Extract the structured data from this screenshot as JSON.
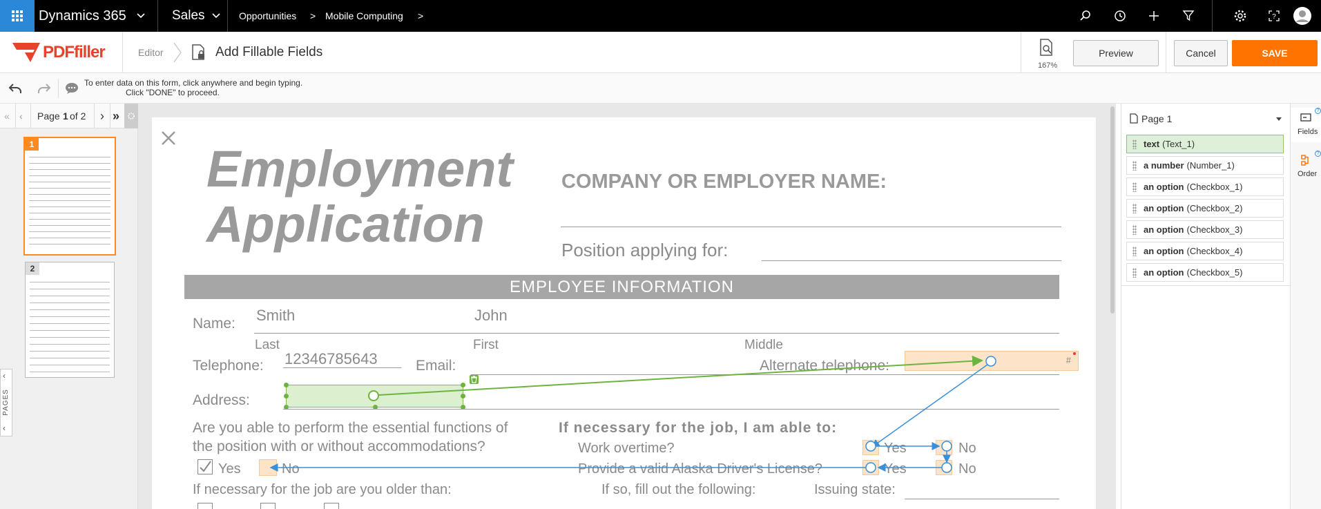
{
  "topbar": {
    "app_name": "Dynamics 365",
    "module": "Sales",
    "breadcrumb": [
      "Opportunities",
      "Mobile Computing"
    ],
    "icons": [
      "search-icon",
      "history-icon",
      "plus-icon",
      "filter-icon",
      "gear-icon",
      "help-icon",
      "user-icon"
    ]
  },
  "editor": {
    "logo": "PDFfiller",
    "crumb_editor": "Editor",
    "title": "Add Fillable Fields",
    "zoom": "167%",
    "preview_label": "Preview",
    "cancel_label": "Cancel",
    "save_label": "SAVE",
    "hint_line1": "To enter data on this form, click anywhere and begin typing.",
    "hint_line2": "Click \"DONE\" to proceed."
  },
  "pager": {
    "prefix": "Page",
    "current": "1",
    "of": "of 2"
  },
  "thumbnails": [
    {
      "num": "1"
    },
    {
      "num": "2"
    }
  ],
  "pages_label": "PAGES",
  "doc": {
    "title1": "Employment",
    "title2": "Application",
    "company": "COMPANY OR EMPLOYER NAME:",
    "position": "Position applying for:",
    "band": "EMPLOYEE INFORMATION",
    "name_label": "Name:",
    "last_value": "Smith",
    "first_value": "John",
    "last_label": "Last",
    "first_label": "First",
    "middle_label": "Middle",
    "telephone_label": "Telephone:",
    "telephone_value": "12346785643",
    "email_label": "Email:",
    "alt_tel_label": "Alternate telephone:",
    "hash": "#",
    "address_label": "Address:",
    "q1_line1": "Are you able to perform the essential functions of",
    "q1_line2": "the position with or without accommodations?",
    "yes": "Yes",
    "no": "No",
    "able_heading": "If necessary for the job, I am able to:",
    "overtime": "Work overtime?",
    "license": "Provide a valid Alaska Driver's License?",
    "older": "If necessary for the job are you older than:",
    "fill": "If so, fill out the following:",
    "issuing": "Issuing state:"
  },
  "fields_panel": {
    "page_label": "Page 1",
    "items": [
      {
        "type": "text",
        "name": "(Text_1)"
      },
      {
        "type": "a number",
        "name": "(Number_1)"
      },
      {
        "type": "an option",
        "name": "(Checkbox_1)"
      },
      {
        "type": "an option",
        "name": "(Checkbox_2)"
      },
      {
        "type": "an option",
        "name": "(Checkbox_3)"
      },
      {
        "type": "an option",
        "name": "(Checkbox_4)"
      },
      {
        "type": "an option",
        "name": "(Checkbox_5)"
      }
    ]
  },
  "side_tabs": {
    "fields": "Fields",
    "order": "Order"
  },
  "colors": {
    "accent_orange": "#ff7300",
    "flow_green": "#6db33f",
    "flow_blue": "#3a8fd9",
    "field_fill": "#fde3c8",
    "active_item": "#dff0d8"
  }
}
